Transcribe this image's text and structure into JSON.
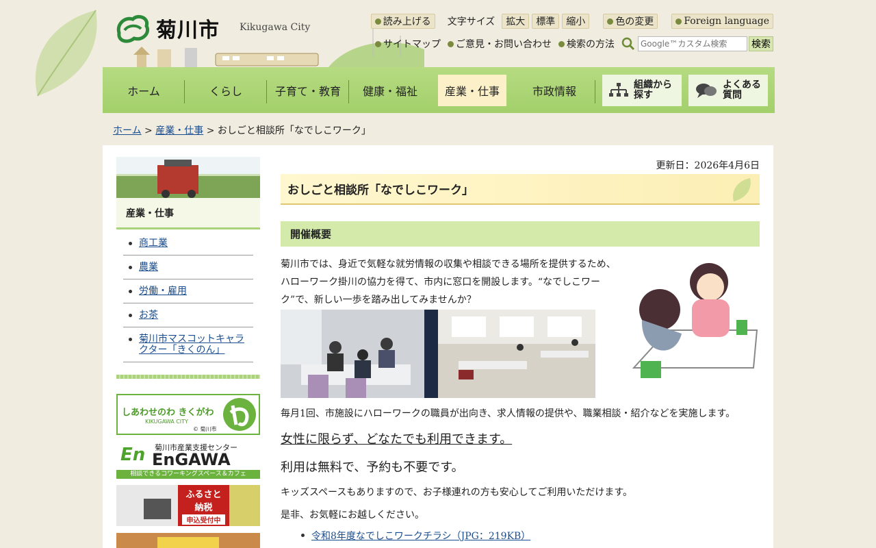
{
  "header": {
    "logo_text": "菊川市",
    "logo_en": "Kikugawa City",
    "read_aloud": "読み上げる",
    "font_size_label": "文字サイズ",
    "font_large": "拡大",
    "font_standard": "標準",
    "font_small": "縮小",
    "color_change": "色の変更",
    "foreign_language": "Foreign language",
    "sitemap": "サイトマップ",
    "contact": "ご意見・お問い合わせ",
    "search_method": "検索の方法",
    "search_placeholder": "Google™カスタム検索",
    "search_button": "検索"
  },
  "nav": {
    "items": [
      "ホーム",
      "くらし",
      "子育て・教育",
      "健康・福祉",
      "産業・仕事",
      "市政情報"
    ],
    "active_index": 4,
    "org_search": "組織から\n探す",
    "faq": "よくある\n質問"
  },
  "breadcrumb": {
    "home": "ホーム",
    "sep": ">",
    "parent": "産業・仕事",
    "current": "おしごと相談所「なでしこワーク」"
  },
  "sidebar": {
    "heading": "産業・仕事",
    "items": [
      "商工業",
      "農業",
      "労働・雇用",
      "お茶",
      "菊川市マスコットキャラクター「きくのん」"
    ],
    "banner1_text": "しあわせのわ きくがわ",
    "banner1_sub": "KIKUGAWA CITY",
    "banner1_credit": "© 菊川市",
    "banner2_title": "EnGAWA",
    "banner2_top": "菊川市産業支援センター",
    "banner2_bottom": "相談できるコワーキングスペース＆カフェ",
    "banner3_line1": "ふるさと",
    "banner3_line2": "納税",
    "banner3_line3": "申込受付中"
  },
  "main": {
    "updated": "更新日：2026年4月6日",
    "title": "おしごと相談所「なでしこワーク」",
    "section_heading": "開催概要",
    "intro": "菊川市では、身近で気軽な就労情報の収集や相談できる場所を提供するため、ハローワーク掛川の協力を得て、市内に窓口を開設します。“なでしこワーク”で、新しい一歩を踏み出してみませんか？",
    "p1": "毎月1回、市施設にハローワークの職員が出向き、求人情報の提供や、職業相談・紹介などを実施します。",
    "big1": "女性に限らず、どなたでも利用できます。",
    "big2": "利用は無料で、予約も不要です。",
    "p2": "キッズスペースもありますので、お子様連れの方も安心してご利用いただけます。",
    "p3": "是非、お気軽にお越しください。",
    "files": [
      "令和8年度なでしこワークチラシ（JPG：219KB）"
    ]
  }
}
